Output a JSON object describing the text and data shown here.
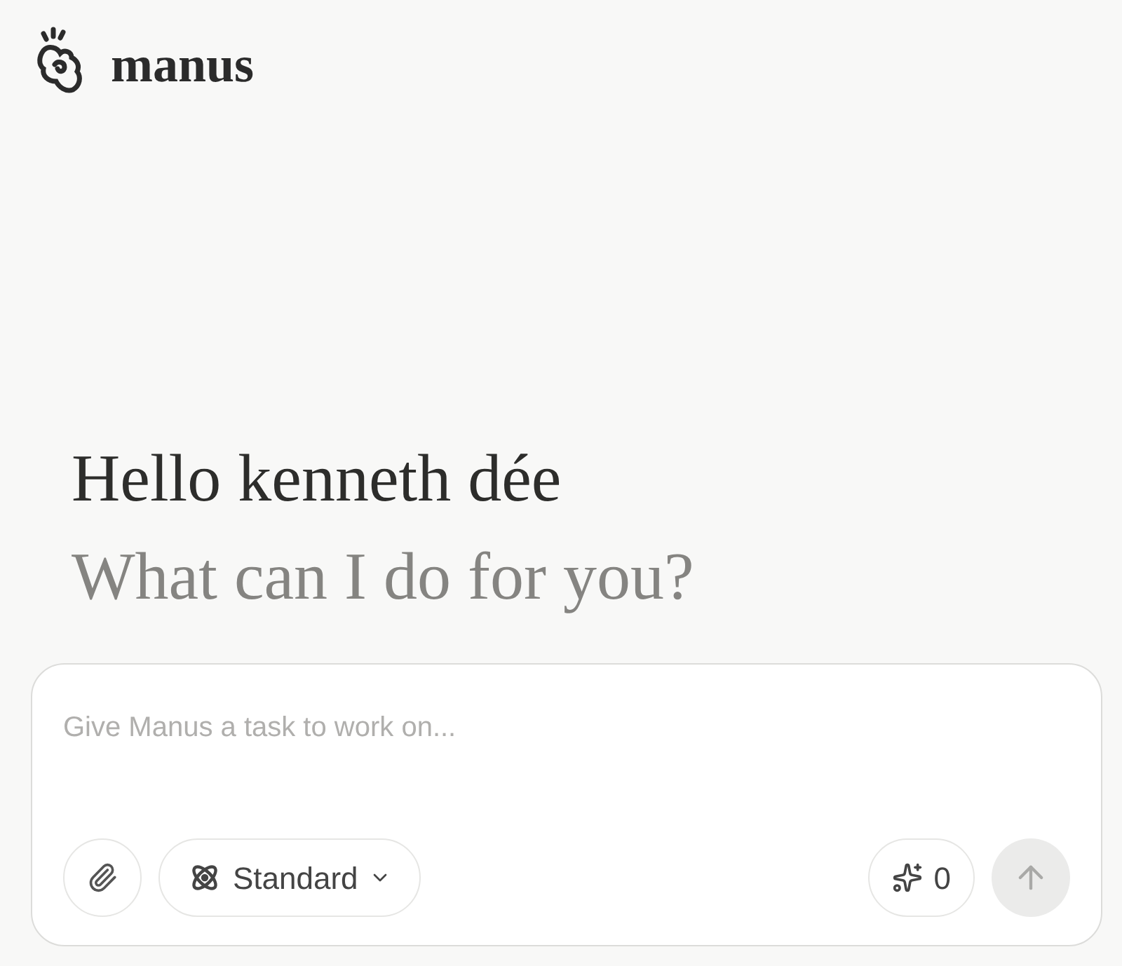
{
  "logo": {
    "text": "manus"
  },
  "greeting": {
    "title": "Hello kenneth dée",
    "subtitle": "What can I do for you?"
  },
  "composer": {
    "placeholder": "Give Manus a task to work on...",
    "mode": {
      "label": "Standard"
    },
    "credits": "0",
    "send": {
      "disabled": true
    }
  }
}
